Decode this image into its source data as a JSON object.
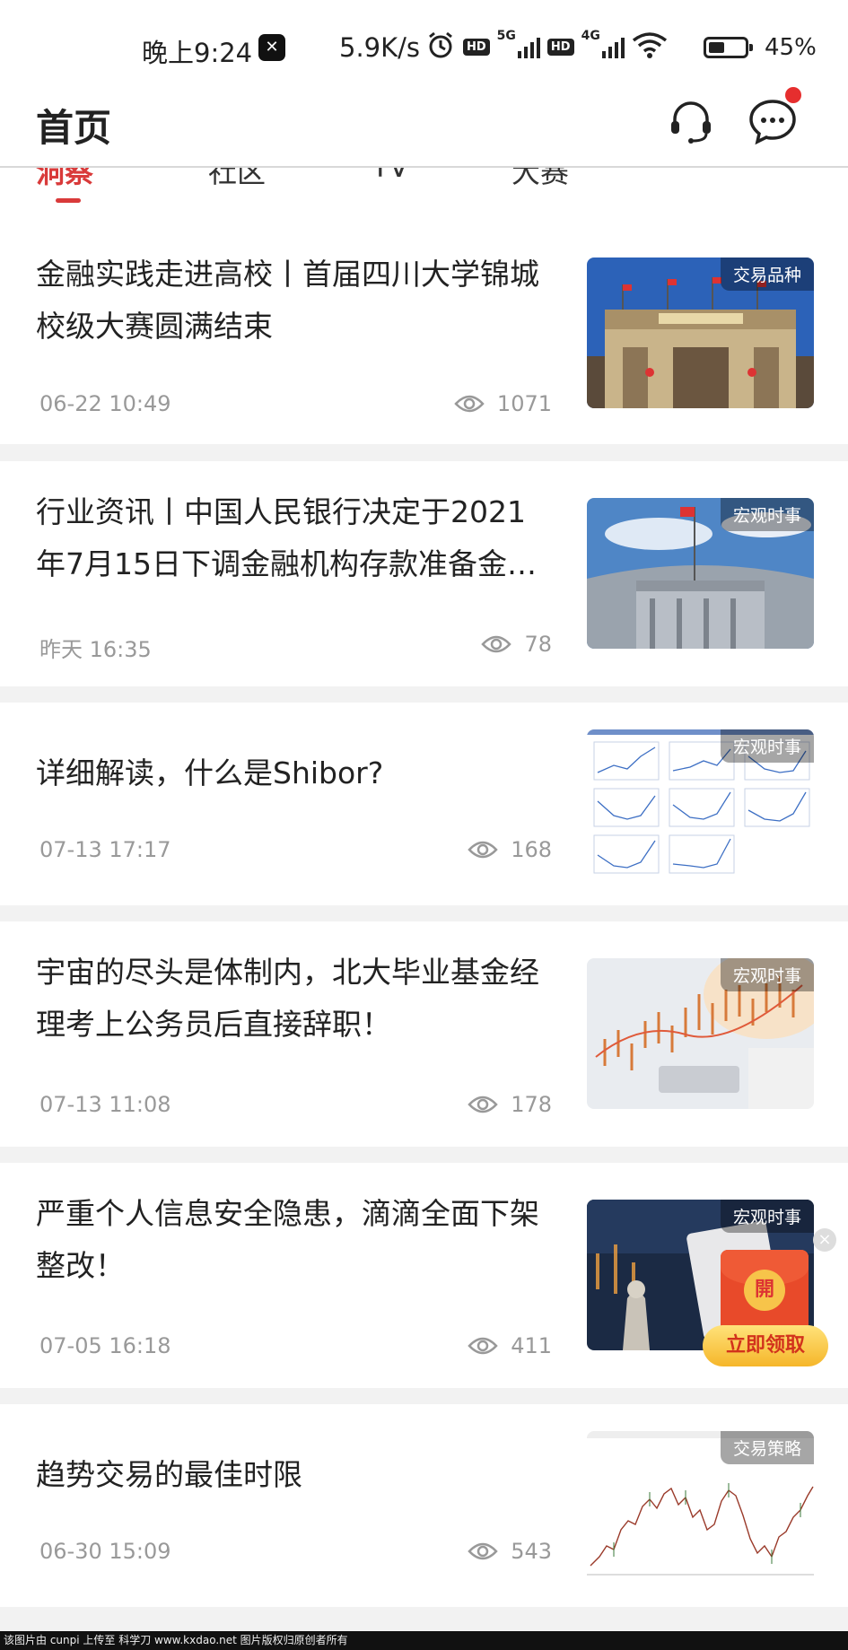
{
  "status_bar": {
    "time": "晚上9:24",
    "net_speed": "5.9K/s",
    "hd_label": "HD",
    "net_5g": "5G",
    "net_4g": "4G",
    "battery_level": 0.45,
    "battery_pct": "45%"
  },
  "header": {
    "title": "首页"
  },
  "tabs": [
    {
      "label": "洞察",
      "active": true
    },
    {
      "label": "社区",
      "active": false
    },
    {
      "label": "TV",
      "active": false
    },
    {
      "label": "大赛",
      "active": false
    }
  ],
  "articles": [
    {
      "title": "金融实践走进高校丨首届四川大学锦城校级大赛圆满结束",
      "date": "06-22 10:49",
      "views": "1071",
      "tag": "交易品种",
      "image": "university-gate"
    },
    {
      "title": "行业资讯丨中国人民银行决定于2021年7月15日下调金融机构存款准备金…",
      "date": "昨天 16:35",
      "views": "78",
      "tag": "宏观时事",
      "image": "central-bank-building"
    },
    {
      "title": "详细解读，什么是Shibor?",
      "date": "07-13 17:17",
      "views": "168",
      "tag": "宏观时事",
      "image": "chart-grid"
    },
    {
      "title": "宇宙的尽头是体制内，北大毕业基金经理考上公务员后直接辞职！",
      "date": "07-13 11:08",
      "views": "178",
      "tag": "宏观时事",
      "image": "finance-hands"
    },
    {
      "title": "严重个人信息安全隐患，滴滴全面下架整改！",
      "date": "07-05 16:18",
      "views": "411",
      "tag": "宏观时事",
      "image": "chess-phone"
    },
    {
      "title": "趋势交易的最佳时限",
      "date": "06-30 15:09",
      "views": "543",
      "tag": "交易策略",
      "image": "candlestick-chart"
    }
  ],
  "red_packet": {
    "coin_label": "開",
    "button_label": "立即领取",
    "close_label": "×"
  },
  "watermark": "该图片由 cunpi 上传至 科学刀 www.kxdao.net 图片版权归原创者所有",
  "colors": {
    "accent": "#d93a3a",
    "notification_dot": "#e62e2e",
    "muted_text": "#999999"
  }
}
